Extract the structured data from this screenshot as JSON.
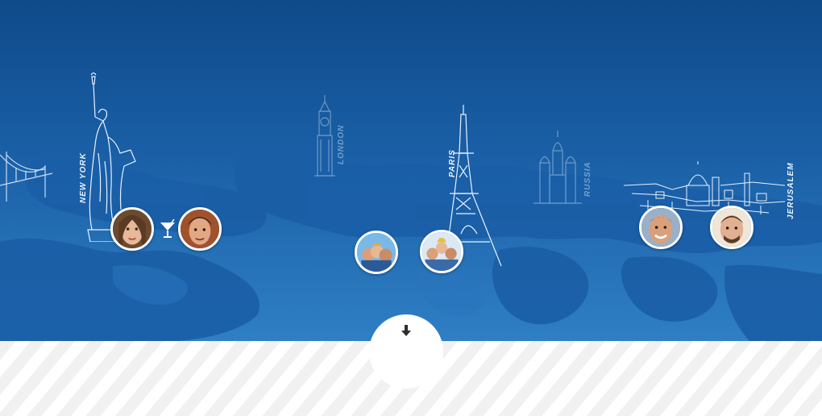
{
  "colors": {
    "sky_top": "#0f4a8a",
    "sky_bottom": "#2f7fc4",
    "map_land": "#1e63a8",
    "outline": "#e8f2ff",
    "stripe": "#f1f1f1"
  },
  "cities": [
    {
      "label": "NEW YORK",
      "landmark": "statue-of-liberty-icon"
    },
    {
      "label": "LONDON",
      "landmark": "big-ben-icon"
    },
    {
      "label": "PARIS",
      "landmark": "eiffel-tower-icon"
    },
    {
      "label": "RUSSIA",
      "landmark": "st-basils-cathedral-icon"
    },
    {
      "label": "JERUSALEM",
      "landmark": "jerusalem-skyline-icon"
    }
  ],
  "icons": {
    "bridge": "golden-gate-bridge-icon",
    "cocktail": "cocktail-icon",
    "scroll": "arrow-down-icon"
  }
}
